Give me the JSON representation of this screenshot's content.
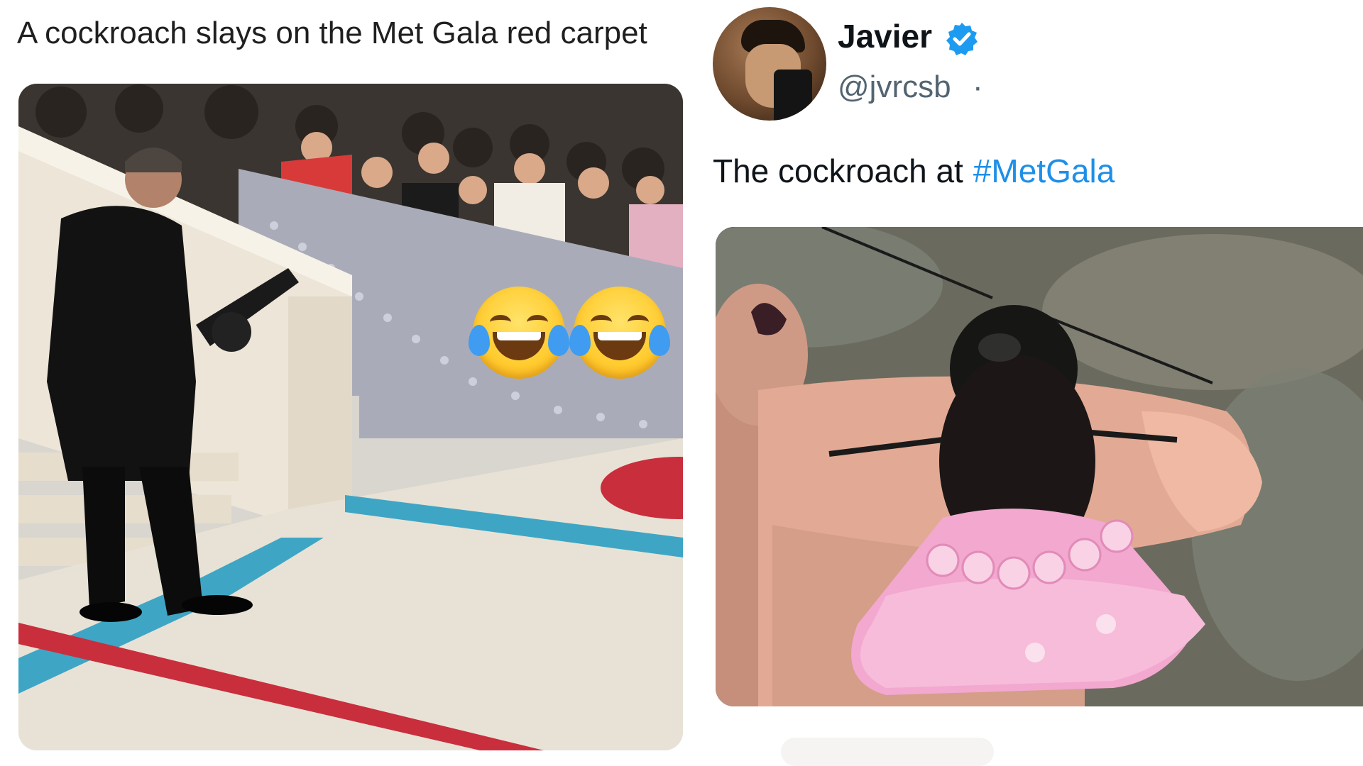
{
  "left_post": {
    "caption": "A cockroach slays on the Met Gala red carpet",
    "photo_icon": "met-gala-photographer-photo",
    "emojis": [
      "face-with-tears-of-joy-icon",
      "face-with-tears-of-joy-icon"
    ]
  },
  "tweet": {
    "author_name": "Javier",
    "author_handle": "@jvrcsb",
    "handle_separator": "·",
    "verified": true,
    "text": "The cockroach at",
    "hashtag": "#MetGala",
    "photo_icon": "cockroach-in-pink-dress-photo"
  },
  "colors": {
    "hashtag": "#1d8fe8",
    "verified": "#1d9bf0",
    "handle": "#536471",
    "carpet_red": "#c92e3d",
    "carpet_blue": "#3ea6c4"
  }
}
